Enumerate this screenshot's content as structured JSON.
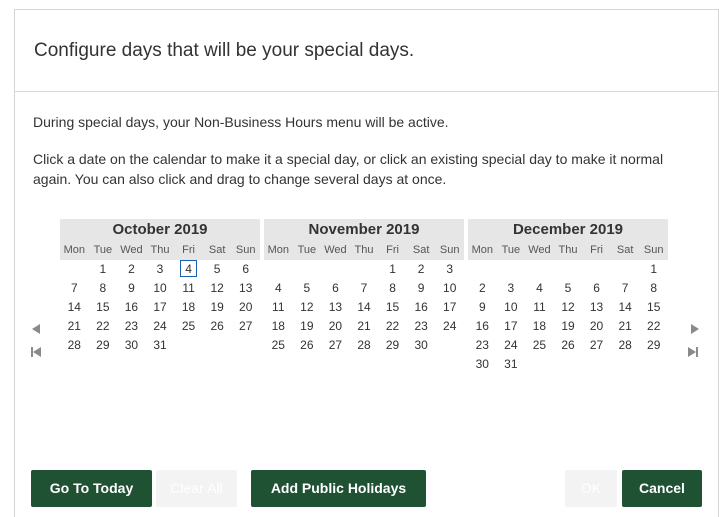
{
  "dialog": {
    "title": "Configure days that will be your special days.",
    "description_1": "During special days, your Non-Business Hours menu will be active.",
    "description_2": "Click a date on the calendar to make it a special day, or click an existing special day to make it normal again. You can also click and drag to change several days at once."
  },
  "weekdays": [
    "Mon",
    "Tue",
    "Wed",
    "Thu",
    "Fri",
    "Sat",
    "Sun"
  ],
  "months": [
    {
      "title": "October 2019",
      "days": [
        "",
        "1",
        "2",
        "3",
        "4",
        "5",
        "6",
        "7",
        "8",
        "9",
        "10",
        "11",
        "12",
        "13",
        "14",
        "15",
        "16",
        "17",
        "18",
        "19",
        "20",
        "21",
        "22",
        "23",
        "24",
        "25",
        "26",
        "27",
        "28",
        "29",
        "30",
        "31"
      ],
      "today": "4"
    },
    {
      "title": "November 2019",
      "days": [
        "",
        "",
        "",
        "",
        "1",
        "2",
        "3",
        "4",
        "5",
        "6",
        "7",
        "8",
        "9",
        "10",
        "11",
        "12",
        "13",
        "14",
        "15",
        "16",
        "17",
        "18",
        "19",
        "20",
        "21",
        "22",
        "23",
        "24",
        "25",
        "26",
        "27",
        "28",
        "29",
        "30"
      ],
      "today": ""
    },
    {
      "title": "December 2019",
      "days": [
        "",
        "",
        "",
        "",
        "",
        "",
        "1",
        "2",
        "3",
        "4",
        "5",
        "6",
        "7",
        "8",
        "9",
        "10",
        "11",
        "12",
        "13",
        "14",
        "15",
        "16",
        "17",
        "18",
        "19",
        "20",
        "21",
        "22",
        "23",
        "24",
        "25",
        "26",
        "27",
        "28",
        "29",
        "30",
        "31"
      ],
      "today": ""
    }
  ],
  "nav": {
    "prev_icon": "triangle-left-icon",
    "first_icon": "skip-first-icon",
    "next_icon": "triangle-right-icon",
    "last_icon": "skip-last-icon"
  },
  "buttons": {
    "go_to_today": "Go To Today",
    "clear_all": "Clear All",
    "add_public_holidays": "Add Public Holidays",
    "ok": "OK",
    "cancel": "Cancel"
  },
  "colors": {
    "primary": "#1f5133",
    "disabled": "#f3f3f3",
    "today_outline": "#1a5fb4"
  }
}
